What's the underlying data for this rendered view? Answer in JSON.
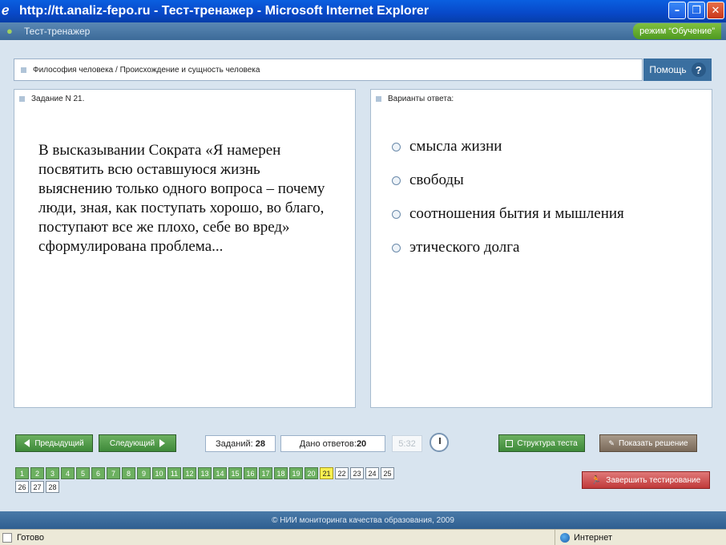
{
  "window": {
    "title": "http://tt.analiz-fepo.ru - Тест-тренажер - Microsoft Internet Explorer"
  },
  "app": {
    "title": "Тест-тренажер",
    "mode": "режим “Обучение”"
  },
  "breadcrumb": "Философия человека / Происхождение и сущность человека",
  "help_label": "Помощь",
  "question": {
    "header": "Задание N 21.",
    "text": "В высказывании Сократа «Я намерен посвятить всю оставшуюся жизнь выяснению только одного вопроса – почему люди, зная, как поступать хорошо, во благо, поступают все же плохо, себе во вред» сформулирована проблема..."
  },
  "answers": {
    "header": "Варианты ответа:",
    "options": [
      "смысла жизни",
      "свободы",
      "соотношения бытия и мышления",
      "этического долга"
    ]
  },
  "nav": {
    "prev": "Предыдущий",
    "next": "Следующий"
  },
  "stats": {
    "tasks_label": "Заданий:",
    "tasks": "28",
    "answered_label": "Дано ответов:",
    "answered": "20",
    "timer": "5:32"
  },
  "actions": {
    "structure": "Структура теста",
    "show_solution": "Показать решение",
    "finish": "Завершить тестирование"
  },
  "questions": {
    "items": [
      "1",
      "2",
      "3",
      "4",
      "5",
      "6",
      "7",
      "8",
      "9",
      "10",
      "11",
      "12",
      "13",
      "14",
      "15",
      "16",
      "17",
      "18",
      "19",
      "20",
      "21",
      "22",
      "23",
      "24",
      "25",
      "26",
      "27",
      "28"
    ],
    "answered_count": 20,
    "current": 21
  },
  "footer": "© НИИ мониторинга качества образования, 2009",
  "statusbar": {
    "left": "Готово",
    "zone": "Интернет"
  }
}
